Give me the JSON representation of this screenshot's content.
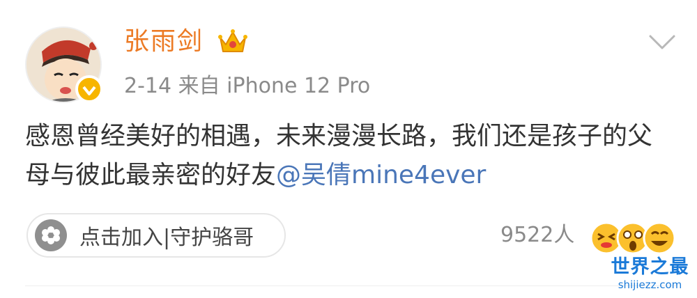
{
  "post": {
    "author": {
      "name": "张雨剑",
      "verified": true
    },
    "meta": "2-14  来自 iPhone 12 Pro",
    "content": {
      "text": "感恩曾经美好的相遇，未来漫漫长路，我们还是孩子的父母与彼此最亲密的好友",
      "mention": "@吴倩mine4ever"
    },
    "group": {
      "label": "点击加入|守护骆哥",
      "icon": "flower-icon"
    },
    "likes": {
      "count": "9522人",
      "reactions": [
        "grin-icon",
        "surprised-icon",
        "laugh-icon"
      ]
    }
  },
  "watermark": {
    "title": "世界之最",
    "url": "shijiezz.com"
  },
  "colors": {
    "username": "#ec7a24",
    "mention": "#4a76b8",
    "meta": "#8a8a8a",
    "verified": "#f7b500",
    "watermark": "#1b7ad8"
  }
}
